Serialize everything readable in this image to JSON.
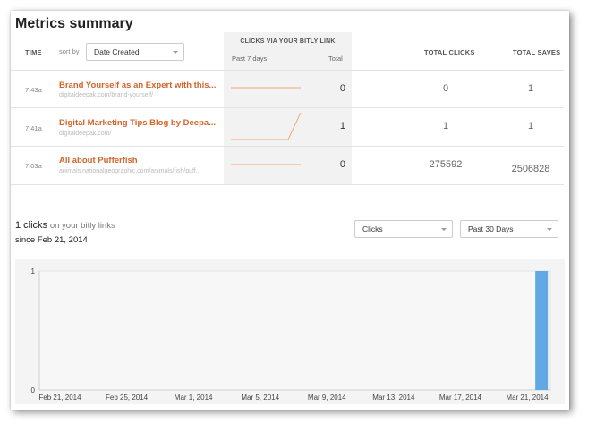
{
  "page_title": "Metrics summary",
  "table": {
    "col_time": "TIME",
    "sort_by_label": "sort by",
    "sort_select_value": "Date Created",
    "clicks_header": "CLICKS VIA YOUR BITLY LINK",
    "clicks_sub_period": "Past 7 days",
    "clicks_sub_total": "Total",
    "col_total_clicks": "TOTAL CLICKS",
    "col_total_saves": "TOTAL SAVES",
    "rows": [
      {
        "time": "7:43a",
        "title": "Brand Yourself as an Expert with this...",
        "url": "digitaldeepak.com/brand-yourself/",
        "bitly_total": "0",
        "total_clicks": "0",
        "total_saves": "1"
      },
      {
        "time": "7:41a",
        "title": "Digital Marketing Tips Blog by Deepa...",
        "url": "digitaldeepak.com/",
        "bitly_total": "1",
        "total_clicks": "1",
        "total_saves": "1"
      },
      {
        "time": "7:03a",
        "title": "All about Pufferfish",
        "url": "animals.nationalgeographic.com/animals/fish/puff...",
        "bitly_total": "0",
        "total_clicks": "275592",
        "total_saves": "2506828"
      }
    ]
  },
  "summary": {
    "clicks_count": "1 clicks",
    "clicks_suffix": "on your bitly links",
    "since": "since Feb 21, 2014",
    "metric_select": "Clicks",
    "range_select": "Past 30 Days"
  },
  "colors": {
    "accent": "#d2642a",
    "bar": "#62a8e5",
    "sparkline": "#f0a878"
  },
  "chart_data": {
    "type": "bar",
    "x": [
      "Feb 21, 2014",
      "Feb 22, 2014",
      "Feb 23, 2014",
      "Feb 24, 2014",
      "Feb 25, 2014",
      "Feb 26, 2014",
      "Feb 27, 2014",
      "Feb 28, 2014",
      "Mar 1, 2014",
      "Mar 2, 2014",
      "Mar 3, 2014",
      "Mar 4, 2014",
      "Mar 5, 2014",
      "Mar 6, 2014",
      "Mar 7, 2014",
      "Mar 8, 2014",
      "Mar 9, 2014",
      "Mar 10, 2014",
      "Mar 11, 2014",
      "Mar 12, 2014",
      "Mar 13, 2014",
      "Mar 14, 2014",
      "Mar 15, 2014",
      "Mar 16, 2014",
      "Mar 17, 2014",
      "Mar 18, 2014",
      "Mar 19, 2014",
      "Mar 20, 2014",
      "Mar 21, 2014"
    ],
    "values": [
      0,
      0,
      0,
      0,
      0,
      0,
      0,
      0,
      0,
      0,
      0,
      0,
      0,
      0,
      0,
      0,
      0,
      0,
      0,
      0,
      0,
      0,
      0,
      0,
      0,
      0,
      0,
      0,
      1
    ],
    "xticks": [
      "Feb 21, 2014",
      "Feb 25, 2014",
      "Mar 1, 2014",
      "Mar 5, 2014",
      "Mar 9, 2014",
      "Mar 13, 2014",
      "Mar 17, 2014",
      "Mar 21, 2014"
    ],
    "yticks": [
      "0",
      "1"
    ],
    "ylim": [
      0,
      1
    ],
    "title": "",
    "xlabel": "",
    "ylabel": ""
  }
}
